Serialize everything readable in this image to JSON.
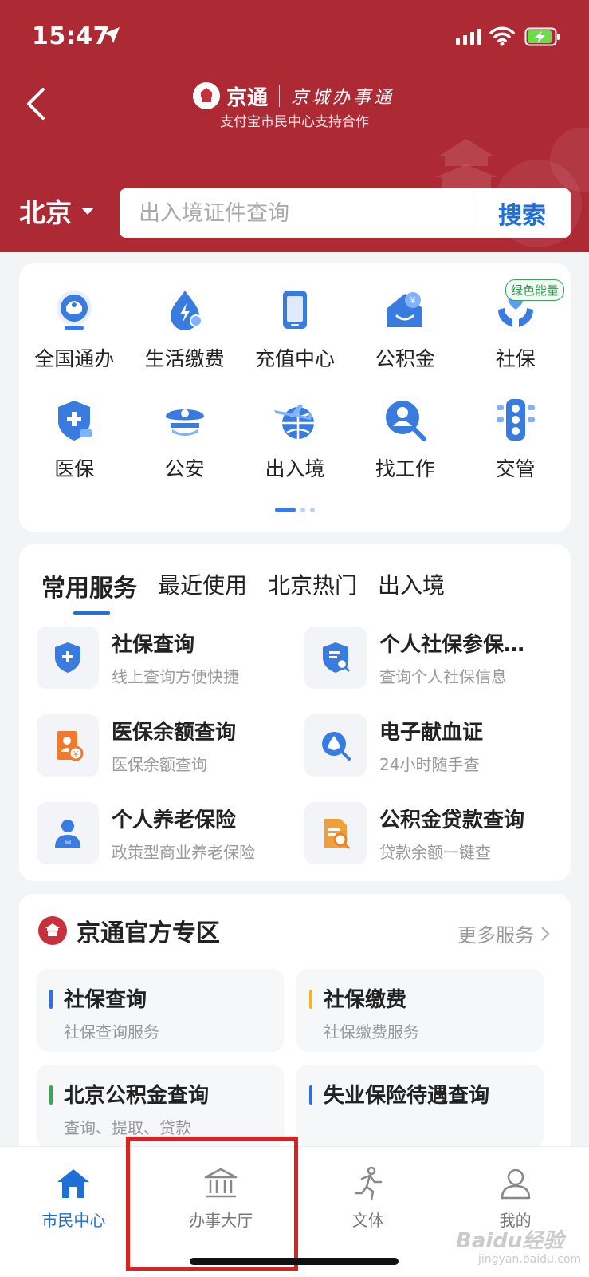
{
  "status_bar": {
    "time": "15:47"
  },
  "header": {
    "brand_name": "京通",
    "brand_slogan": "京城办事通",
    "subtitle": "支付宝市民中心支持合作",
    "city": "北京",
    "search": {
      "placeholder": "出入境证件查询",
      "button_label": "搜索"
    }
  },
  "quick_grid": {
    "items": [
      {
        "label": "全国通办",
        "icon": "national-service-icon"
      },
      {
        "label": "生活缴费",
        "icon": "utility-payment-icon"
      },
      {
        "label": "充值中心",
        "icon": "recharge-icon"
      },
      {
        "label": "公积金",
        "icon": "housing-fund-icon"
      },
      {
        "label": "社保",
        "icon": "social-security-icon",
        "badge": "绿色能量"
      },
      {
        "label": "医保",
        "icon": "medical-insurance-icon"
      },
      {
        "label": "公安",
        "icon": "police-icon"
      },
      {
        "label": "出入境",
        "icon": "exit-entry-icon"
      },
      {
        "label": "找工作",
        "icon": "job-search-icon"
      },
      {
        "label": "交管",
        "icon": "traffic-light-icon"
      }
    ],
    "page_count": 3,
    "active_page": 1
  },
  "services": {
    "tabs": [
      "常用服务",
      "最近使用",
      "北京热门",
      "出入境"
    ],
    "active_tab": 0,
    "items": [
      {
        "title": "社保查询",
        "subtitle": "线上查询方便快捷"
      },
      {
        "title": "个人社保参保…",
        "subtitle": "查询个人社保信息"
      },
      {
        "title": "医保余额查询",
        "subtitle": "医保余额查询"
      },
      {
        "title": "电子献血证",
        "subtitle": "24小时随手查"
      },
      {
        "title": "个人养老保险",
        "subtitle": "政策型商业养老保险"
      },
      {
        "title": "公积金贷款查询",
        "subtitle": "贷款余额一键查"
      }
    ]
  },
  "official_zone": {
    "title": "京通官方专区",
    "more_label": "更多服务",
    "items": [
      {
        "title": "社保查询",
        "subtitle": "社保查询服务",
        "accent": "#2f6fe0"
      },
      {
        "title": "社保缴费",
        "subtitle": "社保缴费服务",
        "accent": "#f0b429"
      },
      {
        "title": "北京公积金查询",
        "subtitle": "查询、提取、贷款",
        "accent": "#3aa65a"
      },
      {
        "title": "失业保险待遇查询",
        "subtitle": "",
        "accent": "#2f6fe0"
      }
    ]
  },
  "tabbar": {
    "items": [
      {
        "label": "市民中心",
        "icon": "home-icon",
        "active": true
      },
      {
        "label": "办事大厅",
        "icon": "government-hall-icon",
        "active": false
      },
      {
        "label": "文体",
        "icon": "sports-icon",
        "active": false
      },
      {
        "label": "我的",
        "icon": "profile-icon",
        "active": false
      }
    ]
  },
  "watermark": {
    "text": "Baidu经验",
    "sub": "jingyan.baidu.com"
  },
  "colors": {
    "header_red": "#ad2a35",
    "primary_blue": "#1f6fd6",
    "highlight_red": "#e0201e"
  }
}
